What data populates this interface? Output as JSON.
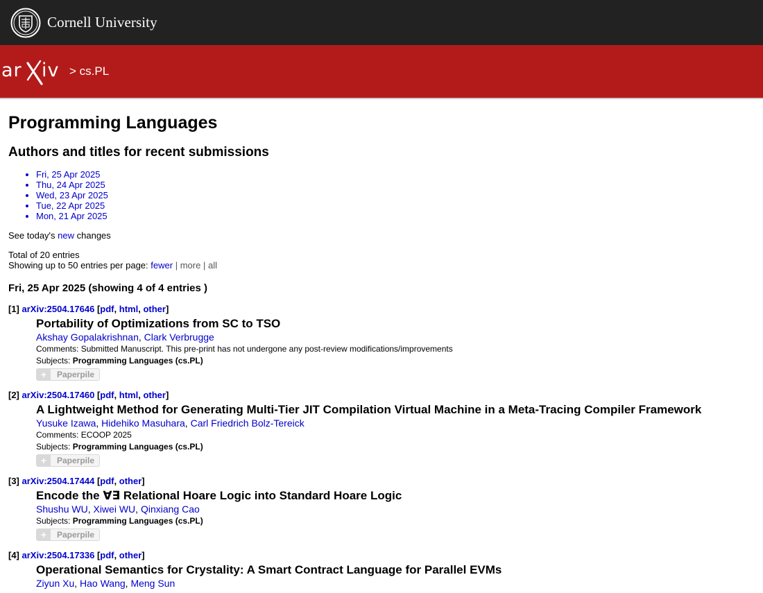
{
  "header": {
    "university": "Cornell University",
    "arxiv_logo": "arXiv",
    "breadcrumb": "> cs.PL"
  },
  "page": {
    "title": "Programming Languages",
    "subtitle": "Authors and titles for recent submissions",
    "dates": [
      "Fri, 25 Apr 2025",
      "Thu, 24 Apr 2025",
      "Wed, 23 Apr 2025",
      "Tue, 22 Apr 2025",
      "Mon, 21 Apr 2025"
    ],
    "see_today_prefix": "See today's",
    "see_today_link": "new",
    "see_today_suffix": "changes",
    "total": "Total of 20 entries",
    "paging_prefix": "Showing up to 50 entries per page:",
    "paging_fewer": "fewer",
    "paging_more": "more",
    "paging_all": "all",
    "section_heading": "Fri, 25 Apr 2025 (showing 4 of 4 entries )"
  },
  "labels": {
    "comments": "Comments:",
    "subjects": "Subjects:",
    "paperpile": "Paperpile"
  },
  "entries": [
    {
      "index": "[1]",
      "id": "arXiv:2504.17646",
      "formats": [
        "pdf",
        "html",
        "other"
      ],
      "title": "Portability of Optimizations from SC to TSO",
      "authors": [
        "Akshay Gopalakrishnan",
        "Clark Verbrugge"
      ],
      "comments": "Submitted Manuscript. This pre-print has not undergone any post-review modifications/improvements",
      "subjects": "Programming Languages (cs.PL)"
    },
    {
      "index": "[2]",
      "id": "arXiv:2504.17460",
      "formats": [
        "pdf",
        "html",
        "other"
      ],
      "title": "A Lightweight Method for Generating Multi-Tier JIT Compilation Virtual Machine in a Meta-Tracing Compiler Framework",
      "authors": [
        "Yusuke Izawa",
        "Hidehiko Masuhara",
        "Carl Friedrich Bolz-Tereick"
      ],
      "comments": "ECOOP 2025",
      "subjects": "Programming Languages (cs.PL)"
    },
    {
      "index": "[3]",
      "id": "arXiv:2504.17444",
      "formats": [
        "pdf",
        "other"
      ],
      "title": "Encode the ∀∃ Relational Hoare Logic into Standard Hoare Logic",
      "authors": [
        "Shushu WU",
        "Xiwei WU",
        "Qinxiang Cao"
      ],
      "comments": "",
      "subjects": "Programming Languages (cs.PL)"
    },
    {
      "index": "[4]",
      "id": "arXiv:2504.17336",
      "formats": [
        "pdf",
        "other"
      ],
      "title": "Operational Semantics for Crystality: A Smart Contract Language for Parallel EVMs",
      "authors": [
        "Ziyun Xu",
        "Hao Wang",
        "Meng Sun"
      ],
      "comments": "",
      "subjects": ""
    }
  ],
  "colors": {
    "topbar": "#222222",
    "brand_red": "#b31b1b",
    "link": "#0000cc"
  }
}
